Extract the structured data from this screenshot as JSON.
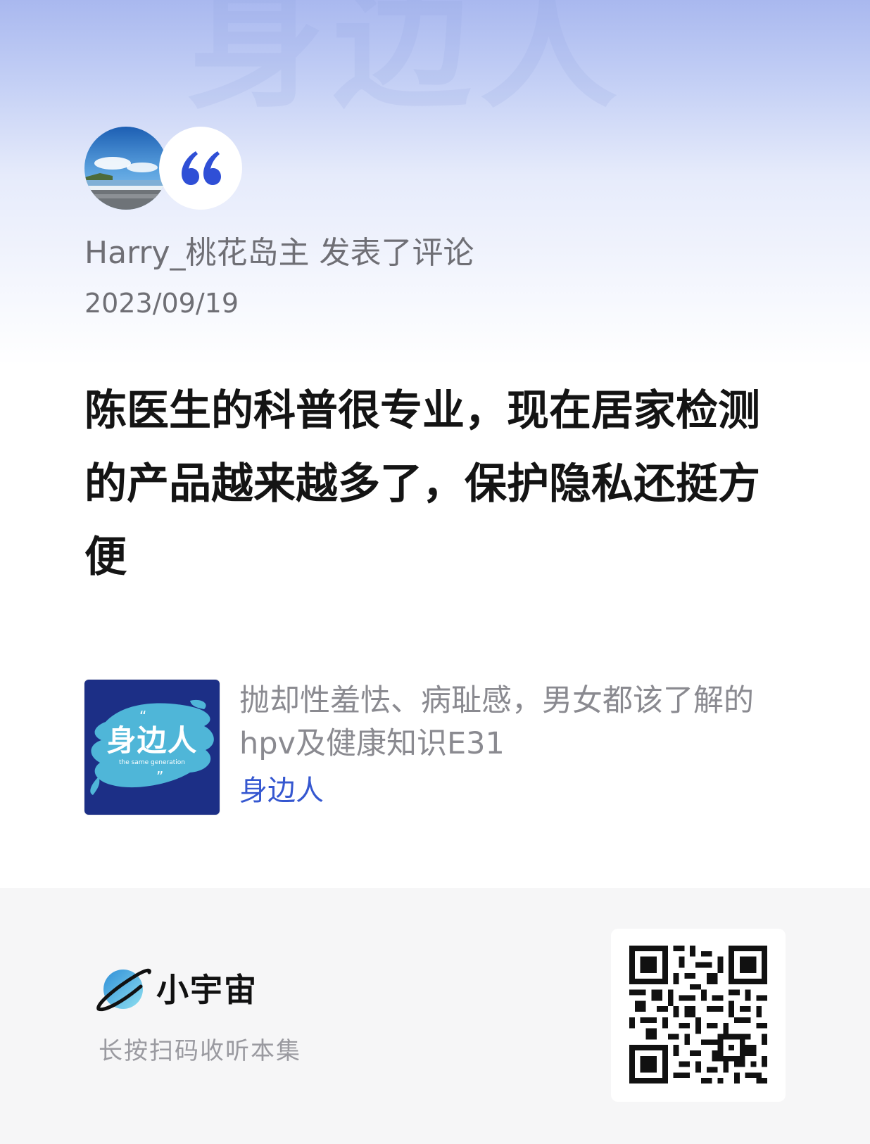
{
  "header": {
    "watermark": "身边人"
  },
  "comment_card": {
    "author": "Harry_桃花岛主",
    "action": "发表了评论",
    "date": "2023/09/19",
    "text": "陈医生的科普很专业，现在居家检测的产品越来越多了，保护隐私还挺方便",
    "quote_icon": "quote-mark-icon"
  },
  "episode": {
    "title": "抛却性羞怯、病耻感，男女都该了解的hpv及健康知识E31",
    "podcast": "身边人",
    "cover_title": "身边人",
    "cover_subtitle": "the same generation",
    "cover_open_quote": "“",
    "cover_close_quote": "”"
  },
  "footer": {
    "brand": "小宇宙",
    "hint": "长按扫码收听本集",
    "logo_icon": "planet-logo-icon",
    "qr_icon": "qr-code-icon"
  },
  "colors": {
    "accent": "#3557d0",
    "quote_blue": "#2f4fd6",
    "cover_navy": "#1c2f86",
    "cover_splash": "#4fb6d8"
  }
}
